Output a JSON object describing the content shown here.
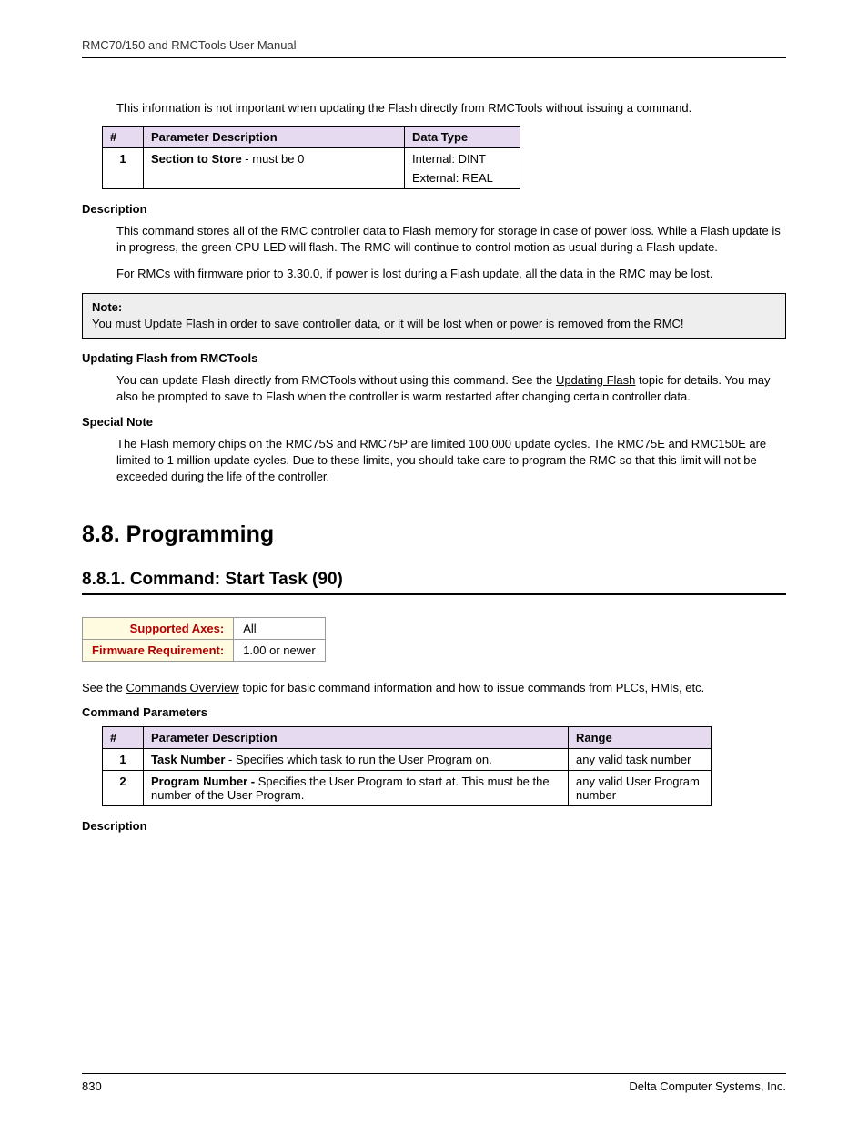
{
  "header": "RMC70/150 and RMCTools User Manual",
  "intro_text": "This information is not important when updating the Flash directly from RMCTools without issuing a command.",
  "table1": {
    "headers": {
      "num": "#",
      "desc": "Parameter Description",
      "type": "Data Type"
    },
    "rows": [
      {
        "num": "1",
        "desc_bold": "Section to Store",
        "desc_rest": " - must be 0",
        "type_line1": "Internal: DINT",
        "type_line2": "External: REAL"
      }
    ]
  },
  "desc_heading": "Description",
  "desc_p1": "This command stores all of the RMC controller data to Flash memory for storage in case of power loss. While a Flash update is in progress, the green CPU LED will flash. The RMC will continue to control motion as usual during a Flash update.",
  "desc_p2": "For RMCs with firmware prior to 3.30.0, if power is lost during a Flash update, all the data in the RMC may be lost.",
  "note_label": "Note:",
  "note_text": "You must Update Flash in order to save controller data, or it will be lost when or power is removed from the RMC!",
  "update_heading": "Updating Flash from RMCTools",
  "update_p_pre": "You can update Flash directly from RMCTools without using this command. See the ",
  "update_link": "Updating Flash",
  "update_p_post": " topic for details. You may also be prompted to save to Flash when the controller is warm restarted after changing certain controller data.",
  "special_heading": "Special Note",
  "special_p": "The Flash memory chips on the RMC75S and RMC75P are limited 100,000 update cycles. The RMC75E and RMC150E are limited to 1 million update cycles. Due to these limits, you should take care to program the RMC so that this limit will not be exceeded during the life of the controller.",
  "h1": "8.8. Programming",
  "h2": "8.8.1. Command: Start Task (90)",
  "info": {
    "row1_label": "Supported Axes:",
    "row1_val": "All",
    "row2_label": "Firmware Requirement:",
    "row2_val": "1.00 or newer"
  },
  "see_pre": "See the ",
  "see_link": "Commands Overview",
  "see_post": " topic for basic command information and how to issue commands from PLCs, HMIs, etc.",
  "params_heading": "Command Parameters",
  "table2": {
    "headers": {
      "num": "#",
      "desc": "Parameter Description",
      "range": "Range"
    },
    "rows": [
      {
        "num": "1",
        "desc_bold": "Task Number",
        "desc_rest": " - Specifies which task to run the User Program on.",
        "range": "any valid task number"
      },
      {
        "num": "2",
        "desc_bold": "Program Number - ",
        "desc_rest": "Specifies the User Program to start at. This must be the number of the User Program.",
        "range": "any valid User Program number"
      }
    ]
  },
  "desc2_heading": "Description",
  "footer_page": "830",
  "footer_company": "Delta Computer Systems, Inc."
}
